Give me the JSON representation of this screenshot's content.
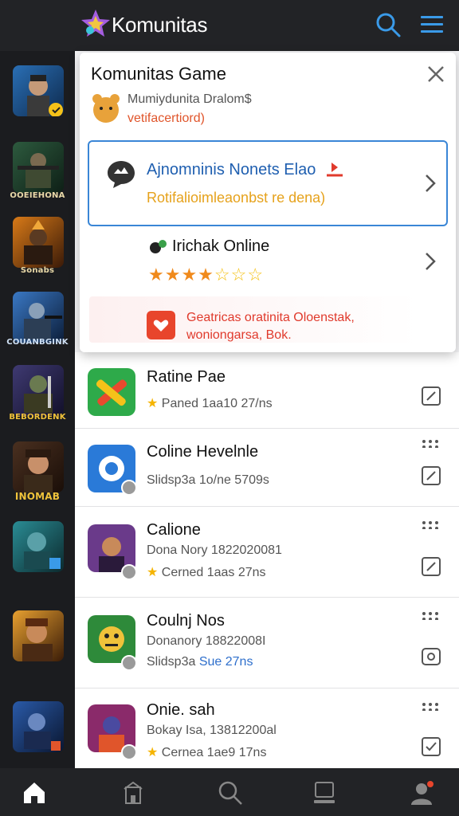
{
  "app": {
    "title": "Komunitas"
  },
  "panel": {
    "title": "Komunitas Game",
    "subtitle": "Mumiydunita Dralom$",
    "subtitle2": "vetifacertiord)",
    "card": {
      "title": "Ajnomninis Nonets Elao",
      "subtitle": "Rotifalioimleaonbst re dena)"
    },
    "online": {
      "title": "Irichak Online",
      "stars": "★★★★☆☆☆"
    },
    "alert": {
      "line1": "Geatricas oratinita Oloenstak,",
      "line2": "woniongarsa, Bok."
    }
  },
  "rail": {
    "labels": [
      "",
      "OOEIEHONA",
      "Sonabs",
      "COUANBGINK",
      "BEBORDENK",
      "INOMAB",
      "",
      "",
      ""
    ]
  },
  "rows": [
    {
      "title": "Ratine Pae",
      "line1": "Paned 1aa10 27/ns",
      "line2": ""
    },
    {
      "title": "Coline Hevelnle",
      "line1": "Slidsp3a 1o/ne 5709s",
      "line2": ""
    },
    {
      "title": "Calione",
      "line1": "Dona Nory 1822020081",
      "line2": "Cerned 1aas 27ns"
    },
    {
      "title": "Coulnj Nos",
      "line1": "Donanory 18822008I",
      "line2": "Slidsp3a",
      "line2b": "Sue 27ns"
    },
    {
      "title": "Onie. sah",
      "line1": "Bokay Isa, 13812200al",
      "line2": "Cernea 1ae9 17ns"
    }
  ],
  "colors": {
    "accent": "#3a86d6",
    "topbar": "#222326",
    "alert": "#e03a2c"
  }
}
